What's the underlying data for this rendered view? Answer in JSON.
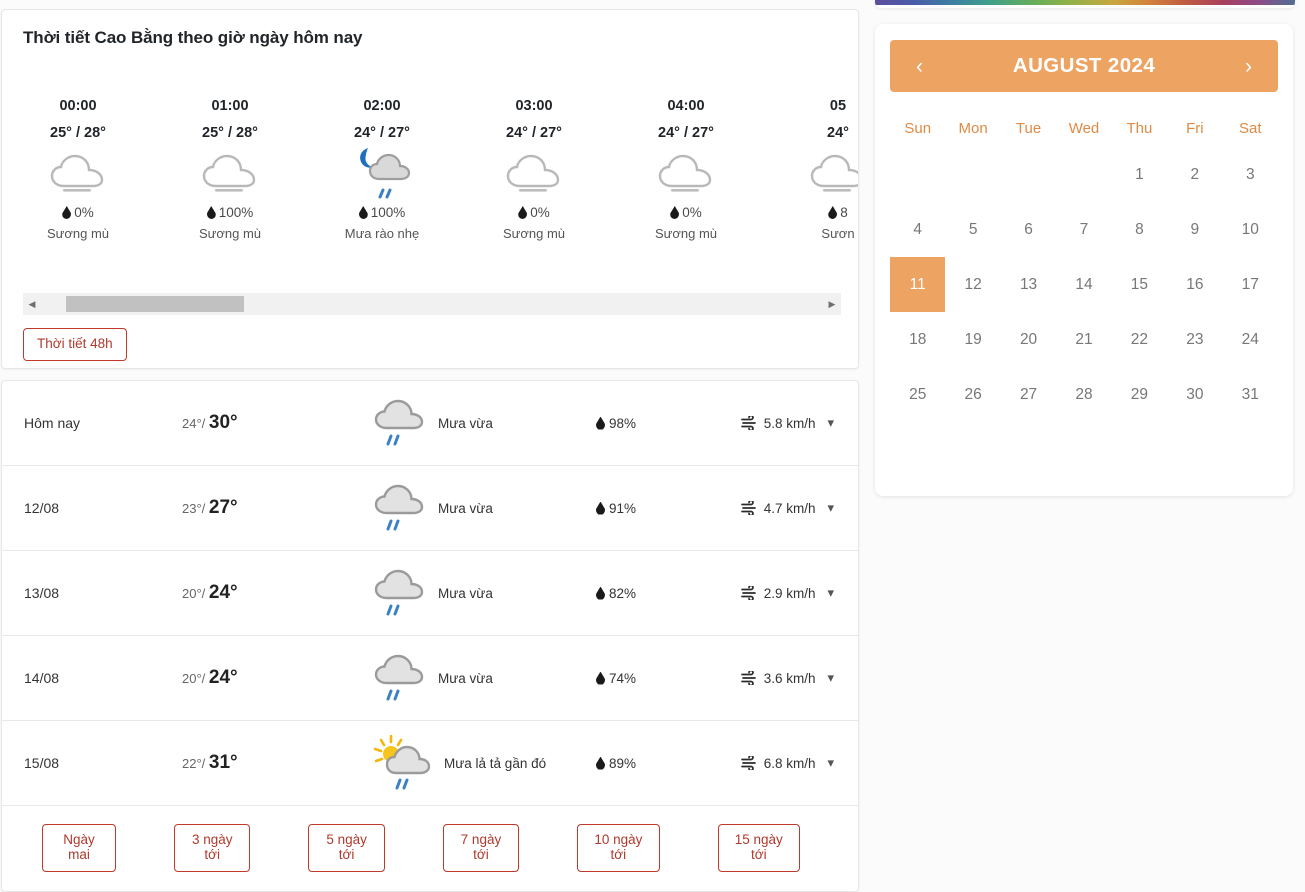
{
  "hourly": {
    "title": "Thời tiết Cao Bằng theo giờ ngày hôm nay",
    "button_48h": "Thời tiết 48h",
    "columns": [
      {
        "time": "00:00",
        "temp": "25° / 28°",
        "pop": "0%",
        "desc": "Sương mù",
        "icon": "cloud-outline-icon"
      },
      {
        "time": "01:00",
        "temp": "25° / 28°",
        "pop": "100%",
        "desc": "Sương mù",
        "icon": "cloud-outline-icon"
      },
      {
        "time": "02:00",
        "temp": "24° / 27°",
        "pop": "100%",
        "desc": "Mưa rào nhẹ",
        "icon": "moon-cloud-rain-icon"
      },
      {
        "time": "03:00",
        "temp": "24° / 27°",
        "pop": "0%",
        "desc": "Sương mù",
        "icon": "cloud-outline-icon"
      },
      {
        "time": "04:00",
        "temp": "24° / 27°",
        "pop": "0%",
        "desc": "Sương mù",
        "icon": "cloud-outline-icon"
      },
      {
        "time": "05",
        "temp": "24°",
        "pop": "8",
        "desc": "Sươn",
        "icon": "cloud-outline-icon"
      }
    ]
  },
  "daily": {
    "rows": [
      {
        "date": "Hôm nay",
        "temp_min": "24°",
        "temp_max": "30°",
        "condition": "Mưa vừa",
        "humidity": "98%",
        "wind": "5.8 km/h",
        "icon": "cloud-rain-icon"
      },
      {
        "date": "12/08",
        "temp_min": "23°",
        "temp_max": "27°",
        "condition": "Mưa vừa",
        "humidity": "91%",
        "wind": "4.7 km/h",
        "icon": "cloud-rain-icon"
      },
      {
        "date": "13/08",
        "temp_min": "20°",
        "temp_max": "24°",
        "condition": "Mưa vừa",
        "humidity": "82%",
        "wind": "2.9 km/h",
        "icon": "cloud-rain-icon"
      },
      {
        "date": "14/08",
        "temp_min": "20°",
        "temp_max": "24°",
        "condition": "Mưa vừa",
        "humidity": "74%",
        "wind": "3.6 km/h",
        "icon": "cloud-rain-icon"
      },
      {
        "date": "15/08",
        "temp_min": "22°",
        "temp_max": "31°",
        "condition": "Mưa lả tả gần đó",
        "humidity": "89%",
        "wind": "6.8 km/h",
        "icon": "sun-cloud-rain-icon"
      }
    ],
    "range_buttons": [
      "Ngày mai",
      "3 ngày tới",
      "5 ngày tới",
      "7 ngày tới",
      "10 ngày tới",
      "15 ngày tới"
    ]
  },
  "calendar": {
    "title": "AUGUST 2024",
    "prev_label": "‹",
    "next_label": "›",
    "weekdays": [
      "Sun",
      "Mon",
      "Tue",
      "Wed",
      "Thu",
      "Fri",
      "Sat"
    ],
    "leading_blanks": 4,
    "days": [
      1,
      2,
      3,
      4,
      5,
      6,
      7,
      8,
      9,
      10,
      11,
      12,
      13,
      14,
      15,
      16,
      17,
      18,
      19,
      20,
      21,
      22,
      23,
      24,
      25,
      26,
      27,
      28,
      29,
      30,
      31
    ],
    "selected_day": 11,
    "accent_color": "#eda362",
    "weekday_color": "#e08b45"
  },
  "colors": {
    "outline_button_border": "#c0392b",
    "outline_button_text": "#b0392b",
    "rain_streak": "#3b82c4",
    "cloud_grey": "#9e9e9e",
    "sun_yellow": "#f5c518"
  }
}
